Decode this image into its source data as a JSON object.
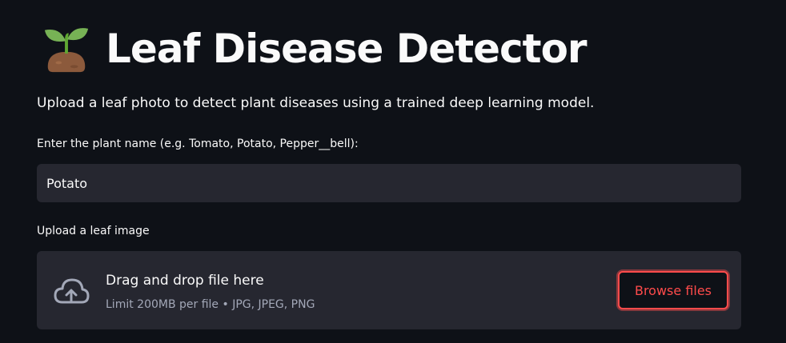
{
  "header": {
    "title": "Leaf Disease Detector",
    "icon": "seedling-icon"
  },
  "intro": {
    "text": "Upload a leaf photo to detect plant diseases using a trained deep learning model."
  },
  "plant_input": {
    "label": "Enter the plant name (e.g. Tomato, Potato, Pepper__bell):",
    "value": "Potato",
    "placeholder": ""
  },
  "uploader": {
    "label": "Upload a leaf image",
    "drop_text": "Drag and drop file here",
    "limit_text": "Limit 200MB per file • JPG, JPEG, PNG",
    "browse_label": "Browse files",
    "icon": "cloud-upload-icon"
  },
  "colors": {
    "background": "#0e1117",
    "surface": "#262730",
    "accent": "#ff4b4b",
    "text": "#fafafa",
    "muted_text": "#a3a8b8"
  }
}
